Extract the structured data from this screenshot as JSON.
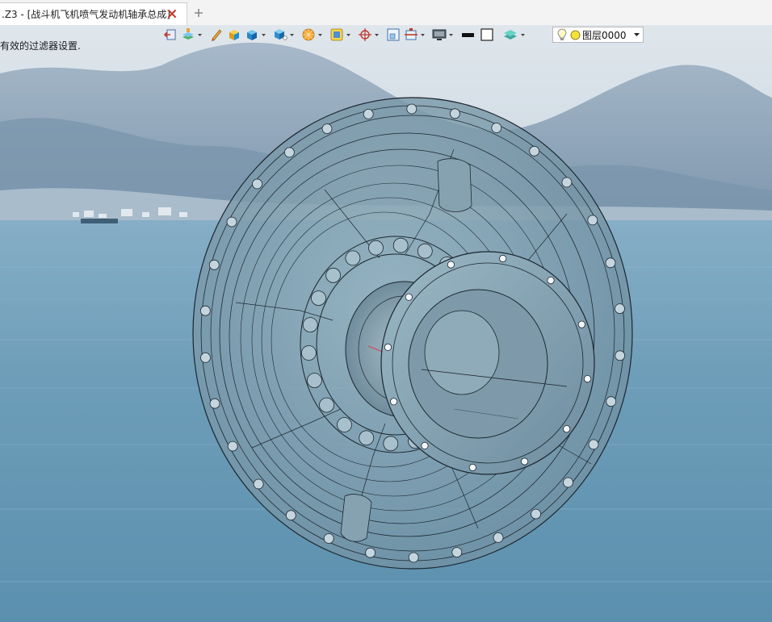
{
  "tab": {
    "title": ".Z3 - [战斗机飞机喷气发动机轴承总成]",
    "close_icon": "close-icon",
    "new_tab_icon": "plus-icon"
  },
  "status": {
    "message": "有效的过滤器设置."
  },
  "toolbar": {
    "buttons": [
      {
        "name": "exit-sketch-icon",
        "has_dropdown": false
      },
      {
        "name": "layer-manager-icon",
        "has_dropdown": true
      },
      {
        "name": "pencil-edit-icon",
        "has_dropdown": false
      },
      {
        "name": "solid-shaded-icon",
        "has_dropdown": false
      },
      {
        "name": "cube-view-icon",
        "has_dropdown": true
      },
      {
        "name": "view-orientation-icon",
        "has_dropdown": true
      },
      {
        "name": "render-mode-icon",
        "has_dropdown": true
      },
      {
        "name": "filter-icon",
        "has_dropdown": true
      },
      {
        "name": "snap-point-icon",
        "has_dropdown": true
      },
      {
        "name": "window-zoom-icon",
        "has_dropdown": false
      },
      {
        "name": "section-view-icon",
        "has_dropdown": true
      },
      {
        "name": "display-screen-icon",
        "has_dropdown": true
      },
      {
        "name": "line-color-icon",
        "has_dropdown": false
      },
      {
        "name": "face-color-icon",
        "has_dropdown": false
      },
      {
        "name": "layer-stack-icon",
        "has_dropdown": true
      }
    ],
    "layer": {
      "value": "图层0000",
      "bulb_icon": "lightbulb-icon",
      "status_icon": "layer-active-icon"
    }
  },
  "colors": {
    "accent": "#1e6fd0",
    "model_fill": "#8aa7b6",
    "model_line": "#1b2730",
    "sky": "#d5dee6",
    "water": "#6e9fb9"
  }
}
